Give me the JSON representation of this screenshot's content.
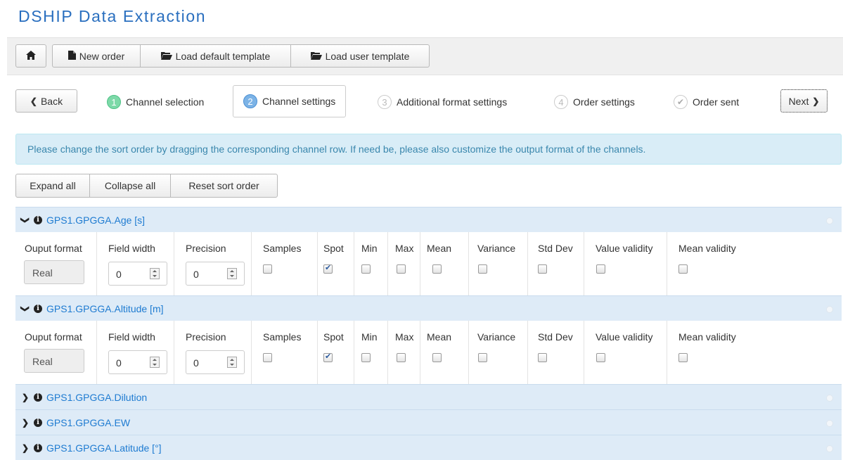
{
  "app": {
    "title": "DSHIP Data Extraction"
  },
  "toolbar": {
    "home_icon": "home-icon",
    "new_order": "New order",
    "load_default": "Load default template",
    "load_user": "Load user template"
  },
  "wizard": {
    "back": "Back",
    "next": "Next",
    "steps": [
      {
        "num": "1",
        "label": "Channel selection",
        "state": "done"
      },
      {
        "num": "2",
        "label": "Channel settings",
        "state": "active"
      },
      {
        "num": "3",
        "label": "Additional format settings",
        "state": "todo"
      },
      {
        "num": "4",
        "label": "Order settings",
        "state": "todo"
      },
      {
        "num": "",
        "label": "Order sent",
        "state": "todo"
      }
    ]
  },
  "info_message": "Please change the sort order by dragging the corresponding channel row. If need be, please also customize the output format of the channels.",
  "actions": {
    "expand": "Expand all",
    "collapse": "Collapse all",
    "reset": "Reset sort order"
  },
  "columns": {
    "output_format": "Ouput format",
    "field_width": "Field width",
    "precision": "Precision",
    "samples": "Samples",
    "spot": "Spot",
    "min": "Min",
    "max": "Max",
    "mean": "Mean",
    "variance": "Variance",
    "std_dev": "Std Dev",
    "value_validity": "Value validity",
    "mean_validity": "Mean validity"
  },
  "channels": [
    {
      "name": "GPS1.GPGGA.Age [s]",
      "expanded": true,
      "format": "Real",
      "field_width": "0",
      "precision": "0",
      "checks": {
        "samples": false,
        "spot": true,
        "min": false,
        "max": false,
        "mean": false,
        "variance": false,
        "std_dev": false,
        "value_validity": false,
        "mean_validity": false
      }
    },
    {
      "name": "GPS1.GPGGA.Altitude [m]",
      "expanded": true,
      "format": "Real",
      "field_width": "0",
      "precision": "0",
      "checks": {
        "samples": false,
        "spot": true,
        "min": false,
        "max": false,
        "mean": false,
        "variance": false,
        "std_dev": false,
        "value_validity": false,
        "mean_validity": false
      }
    },
    {
      "name": "GPS1.GPGGA.Dilution",
      "expanded": false
    },
    {
      "name": "GPS1.GPGGA.EW",
      "expanded": false
    },
    {
      "name": "GPS1.GPGGA.Latitude [°]",
      "expanded": false
    }
  ]
}
